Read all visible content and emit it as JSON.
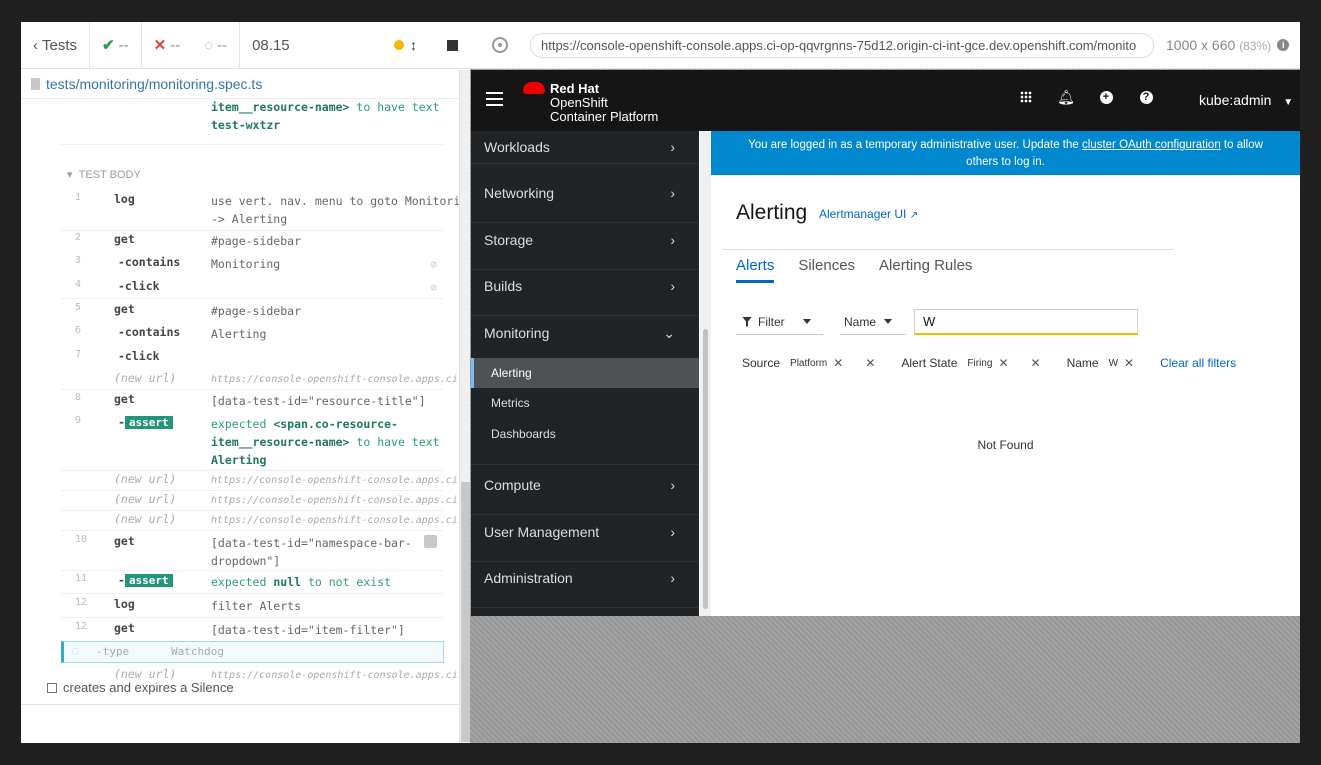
{
  "runner": {
    "back_label": "Tests",
    "passed": "--",
    "failed": "--",
    "pending": "--",
    "duration": "08.15",
    "spec_path": "tests/monitoring/monitoring.spec.ts",
    "section_label": "TEST BODY",
    "top_partial": {
      "msg1": "item__resource-name>",
      "msg2": "to have text",
      "msg3": "test-wxtzr"
    },
    "commands": [
      {
        "num": "1",
        "name": "log",
        "msg": "use vert. nav. menu to goto Monitoring\n-> Alerting"
      },
      {
        "num": "2",
        "name": "get",
        "msg": "#page-sidebar"
      },
      {
        "num": "3",
        "name": "-contains",
        "msg": "Monitoring"
      },
      {
        "num": "4",
        "name": "-click",
        "msg": ""
      },
      {
        "num": "5",
        "name": "get",
        "msg": "#page-sidebar"
      },
      {
        "num": "6",
        "name": "-contains",
        "msg": "Alerting"
      },
      {
        "num": "7",
        "name": "-click",
        "msg": ""
      },
      {
        "num": "",
        "name": "(new url)",
        "msg": "https://console-openshift-console.apps.ci-o…"
      },
      {
        "num": "8",
        "name": "get",
        "msg": "[data-test-id=\"resource-title\"]"
      },
      {
        "num": "9",
        "name": "assert",
        "msg1": "expected",
        "msg2": "<span.co-resource-",
        "msg3": "item__resource-name>",
        "msg4": "to have text",
        "msg5": "Alerting"
      },
      {
        "num": "",
        "name": "(new url)",
        "msg": "https://console-openshift-console.apps.ci-o…"
      },
      {
        "num": "",
        "name": "(new url)",
        "msg": "https://console-openshift-console.apps.ci-o…"
      },
      {
        "num": "",
        "name": "(new url)",
        "msg": "https://console-openshift-console.apps.ci-o…"
      },
      {
        "num": "10",
        "name": "get",
        "msg": "[data-test-id=\"namespace-bar-\ndropdown\"]"
      },
      {
        "num": "11",
        "name": "assert",
        "msg1": "expected",
        "msg2": "null",
        "msg3": "to not exist"
      },
      {
        "num": "12",
        "name": "log",
        "msg": "filter Alerts"
      },
      {
        "num": "12",
        "name": "get",
        "msg": "[data-test-id=\"item-filter\"]"
      },
      {
        "num": "",
        "name": "-type",
        "msg": "Watchdog"
      },
      {
        "num": "",
        "name": "(new url)",
        "msg": "https://console-openshift-console.apps.ci-o…"
      }
    ],
    "next_test": "creates and expires a Silence"
  },
  "browser": {
    "url": "https://console-openshift-console.apps.ci-op-qqvrgnns-75d12.origin-ci-int-gce.dev.openshift.com/monito",
    "viewport": "1000 x 660",
    "zoom": "(83%)"
  },
  "masthead": {
    "brand1": "Red Hat",
    "brand2": "OpenShift",
    "brand3": "Container Platform",
    "user": "kube:admin"
  },
  "nav": {
    "workloads": "Workloads",
    "networking": "Networking",
    "storage": "Storage",
    "builds": "Builds",
    "monitoring": "Monitoring",
    "alerting": "Alerting",
    "metrics": "Metrics",
    "dashboards": "Dashboards",
    "compute": "Compute",
    "user_management": "User Management",
    "administration": "Administration"
  },
  "banner": {
    "before": "You are logged in as a temporary administrative user. Update the ",
    "link": "cluster OAuth configuration",
    "after": " to allow others to log in."
  },
  "page": {
    "title": "Alerting",
    "alertmanager_link": "Alertmanager UI",
    "tabs": [
      "Alerts",
      "Silences",
      "Alerting Rules"
    ],
    "filter_label": "Filter",
    "name_select": "Name",
    "filter_value": "W",
    "chips": {
      "source_cat": "Source",
      "source_val": "Platform",
      "state_cat": "Alert State",
      "state_val": "Firing",
      "name_cat": "Name",
      "name_val": "W",
      "clear_all": "Clear all filters"
    },
    "empty_text": "Not Found"
  },
  "colors": {
    "accent": "#0066cc",
    "banner": "#0088ce",
    "masthead": "#151515",
    "nav": "#212427",
    "assert": "#23957c"
  }
}
